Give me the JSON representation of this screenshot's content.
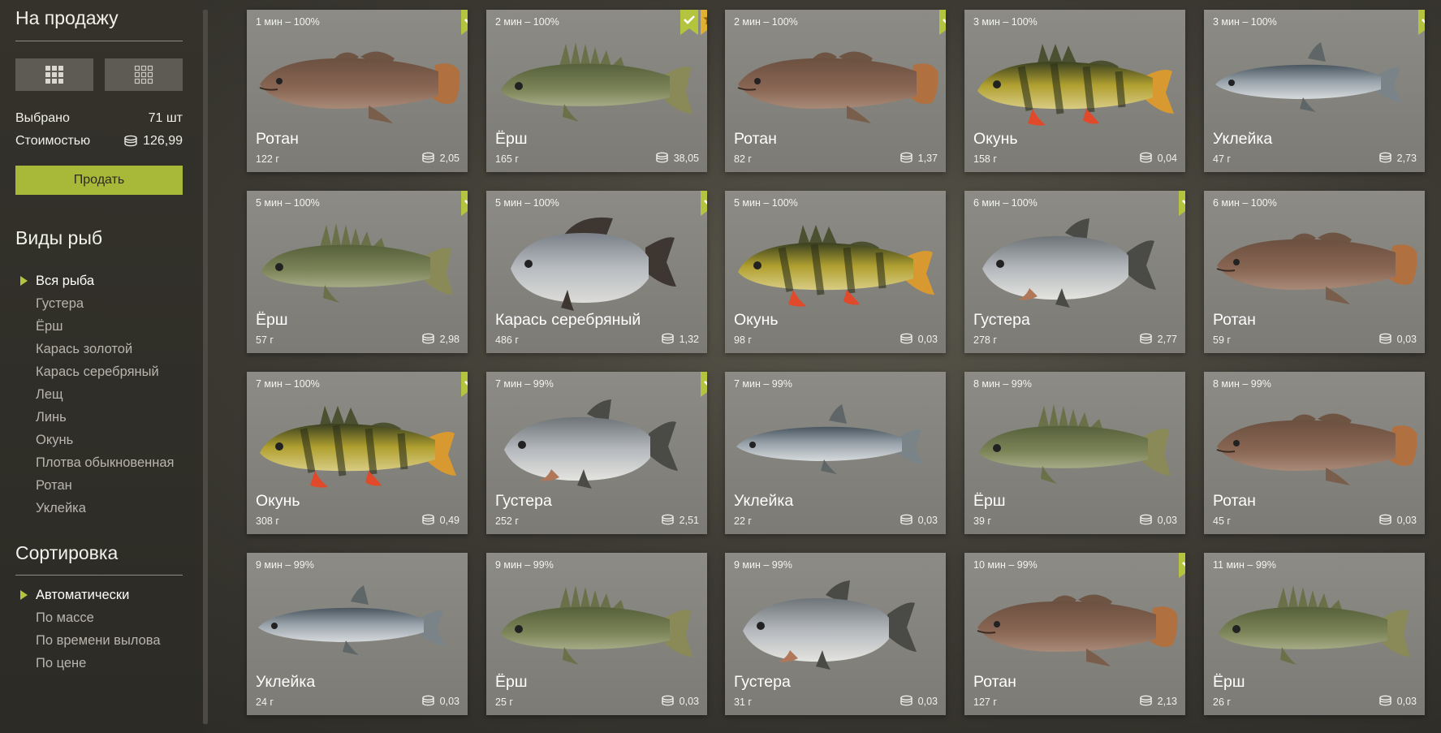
{
  "sidebar": {
    "title": "На продажу",
    "view_buttons": [
      {
        "icon": "grid-large-icon"
      },
      {
        "icon": "grid-small-icon"
      }
    ],
    "selected_label": "Выбрано",
    "selected_value": "71 шт",
    "cost_label": "Стоимостью",
    "cost_value": "126,99",
    "sell_label": "Продать",
    "species_title": "Виды рыб",
    "species": [
      "Вся рыба",
      "Густера",
      "Ёрш",
      "Карась золотой",
      "Карась серебряный",
      "Лещ",
      "Линь",
      "Окунь",
      "Плотва обыкновенная",
      "Ротан",
      "Уклейка"
    ],
    "species_active": 0,
    "sort_title": "Сортировка",
    "sort_options": [
      "Автоматически",
      "По массе",
      "По времени вылова",
      "По цене"
    ],
    "sort_active": 0
  },
  "colors": {
    "accent": "#a8b838",
    "card_bg": "#858480",
    "background": "#3d3b33"
  },
  "fish_cards": [
    {
      "time": "1 мин – 100%",
      "name": "Ротан",
      "weight": "122 г",
      "price": "2,05",
      "check": true,
      "star": false,
      "kind": "rotan"
    },
    {
      "time": "2 мин – 100%",
      "name": "Ёрш",
      "weight": "165 г",
      "price": "38,05",
      "check": true,
      "star": true,
      "kind": "ersh"
    },
    {
      "time": "2 мин – 100%",
      "name": "Ротан",
      "weight": "82 г",
      "price": "1,37",
      "check": true,
      "star": false,
      "kind": "rotan"
    },
    {
      "time": "3 мин – 100%",
      "name": "Окунь",
      "weight": "158 г",
      "price": "0,04",
      "check": false,
      "star": false,
      "kind": "okun"
    },
    {
      "time": "3 мин – 100%",
      "name": "Уклейка",
      "weight": "47 г",
      "price": "2,73",
      "check": true,
      "star": false,
      "kind": "ukleyka"
    },
    {
      "time": "5 мин – 100%",
      "name": "Ёрш",
      "weight": "57 г",
      "price": "2,98",
      "check": true,
      "star": false,
      "kind": "ersh"
    },
    {
      "time": "5 мин – 100%",
      "name": "Карась серебряный",
      "weight": "486 г",
      "price": "1,32",
      "check": true,
      "star": false,
      "kind": "karas"
    },
    {
      "time": "5 мин – 100%",
      "name": "Окунь",
      "weight": "98 г",
      "price": "0,03",
      "check": false,
      "star": false,
      "kind": "okun"
    },
    {
      "time": "6 мин – 100%",
      "name": "Густера",
      "weight": "278 г",
      "price": "2,77",
      "check": true,
      "star": false,
      "kind": "gustera"
    },
    {
      "time": "6 мин – 100%",
      "name": "Ротан",
      "weight": "59 г",
      "price": "0,03",
      "check": false,
      "star": false,
      "kind": "rotan"
    },
    {
      "time": "7 мин – 100%",
      "name": "Окунь",
      "weight": "308 г",
      "price": "0,49",
      "check": true,
      "star": false,
      "kind": "okun"
    },
    {
      "time": "7 мин – 99%",
      "name": "Густера",
      "weight": "252 г",
      "price": "2,51",
      "check": true,
      "star": false,
      "kind": "gustera"
    },
    {
      "time": "7 мин – 99%",
      "name": "Уклейка",
      "weight": "22 г",
      "price": "0,03",
      "check": false,
      "star": false,
      "kind": "ukleyka"
    },
    {
      "time": "8 мин – 99%",
      "name": "Ёрш",
      "weight": "39 г",
      "price": "0,03",
      "check": false,
      "star": false,
      "kind": "ersh"
    },
    {
      "time": "8 мин – 99%",
      "name": "Ротан",
      "weight": "45 г",
      "price": "0,03",
      "check": false,
      "star": false,
      "kind": "rotan"
    },
    {
      "time": "9 мин – 99%",
      "name": "Уклейка",
      "weight": "24 г",
      "price": "0,03",
      "check": false,
      "star": false,
      "kind": "ukleyka"
    },
    {
      "time": "9 мин – 99%",
      "name": "Ёрш",
      "weight": "25 г",
      "price": "0,03",
      "check": false,
      "star": false,
      "kind": "ersh"
    },
    {
      "time": "9 мин – 99%",
      "name": "Густера",
      "weight": "31 г",
      "price": "0,03",
      "check": false,
      "star": false,
      "kind": "gustera"
    },
    {
      "time": "10 мин – 99%",
      "name": "Ротан",
      "weight": "127 г",
      "price": "2,13",
      "check": true,
      "star": false,
      "kind": "rotan"
    },
    {
      "time": "11 мин – 99%",
      "name": "Ёрш",
      "weight": "26 г",
      "price": "0,03",
      "check": false,
      "star": false,
      "kind": "ersh"
    }
  ]
}
